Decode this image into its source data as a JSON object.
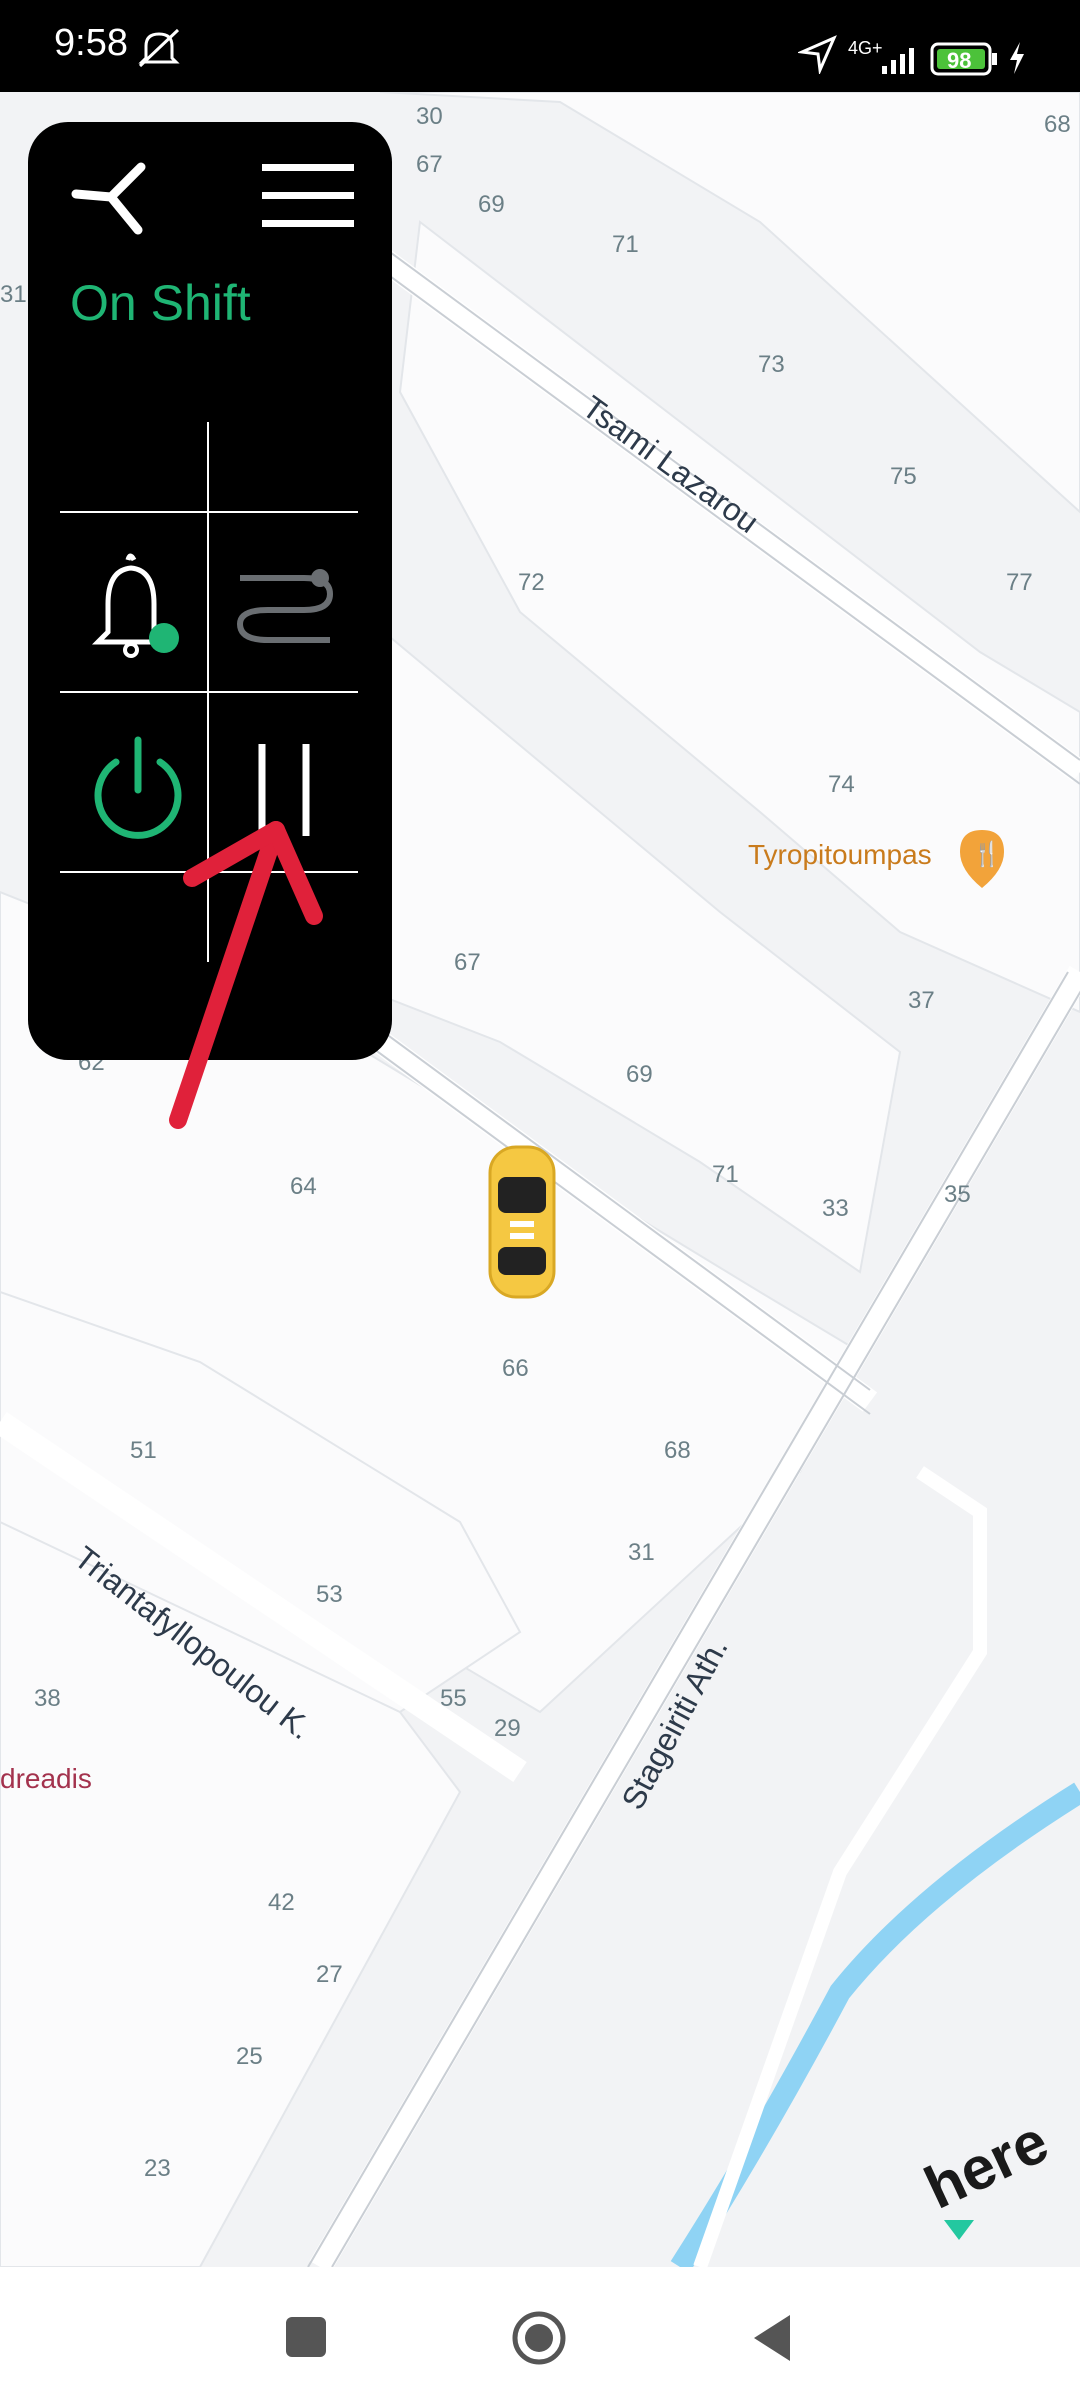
{
  "status_bar": {
    "time": "9:58",
    "network": "4G+",
    "battery_percent": "98"
  },
  "panel": {
    "status_text": "On Shift",
    "menu_icon": "hamburger-menu-icon",
    "logo_icon": "brand-logo-icon",
    "tiles": [
      {
        "icon": "notification-bell-icon",
        "badge_color": "#1fb574"
      },
      {
        "icon": "route-icon"
      },
      {
        "icon": "power-icon",
        "color": "#1fb574"
      },
      {
        "icon": "pause-icon"
      }
    ]
  },
  "map": {
    "streets": [
      "Tsami Lazarou",
      "Triantafyllopoulou K.",
      "Stageiriti Ath."
    ],
    "pois": [
      {
        "name": "Tyropitoumpas",
        "icon": "restaurant-pin-icon",
        "color": "#f2a33a"
      },
      {
        "name": "dreadis"
      }
    ],
    "house_numbers": [
      "30",
      "67",
      "69",
      "71",
      "73",
      "75",
      "77",
      "72",
      "74",
      "67",
      "69",
      "71",
      "33",
      "35",
      "37",
      "64",
      "66",
      "68",
      "51",
      "53",
      "55",
      "29",
      "31",
      "38",
      "42",
      "27",
      "25",
      "23",
      "68",
      "62",
      "31"
    ],
    "vehicle_icon": "taxi-car-icon",
    "logo_text": "here"
  },
  "nav_bar": {
    "recents_icon": "square-recents-icon",
    "home_icon": "circle-home-icon",
    "back_icon": "triangle-back-icon"
  },
  "annotation": {
    "arrow_color": "#e0213a"
  }
}
